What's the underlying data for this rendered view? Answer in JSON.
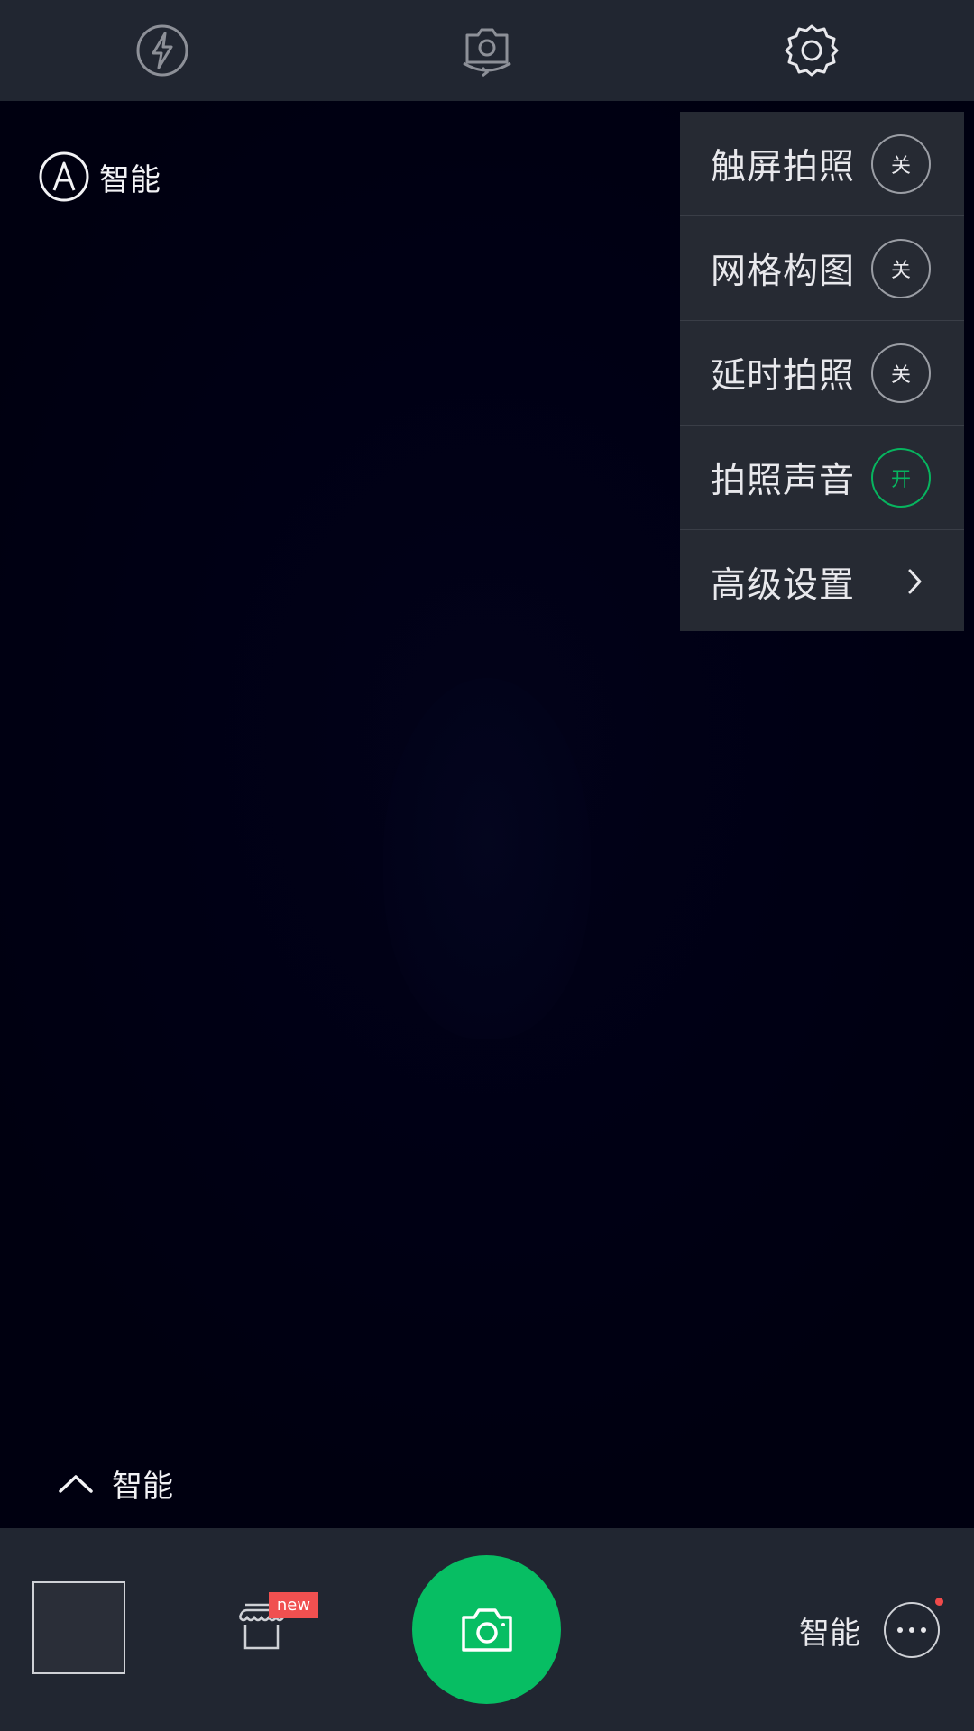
{
  "topbar": {
    "flash_icon": "flash-off-icon",
    "switch_camera_icon": "switch-camera-icon",
    "settings_icon": "gear-icon"
  },
  "viewfinder": {
    "mode_badge": {
      "icon": "auto-mode-icon",
      "label": "智能"
    },
    "scene_selector": {
      "icon": "chevron-up-icon",
      "label": "智能"
    }
  },
  "settings_menu": {
    "items": [
      {
        "label": "触屏拍照",
        "state": "关"
      },
      {
        "label": "网格构图",
        "state": "关"
      },
      {
        "label": "延时拍照",
        "state": "关"
      },
      {
        "label": "拍照声音",
        "state": "开"
      },
      {
        "label": "高级设置",
        "icon": "chevron-right-icon"
      }
    ]
  },
  "bottombar": {
    "gallery_icon": "gallery-thumbnail",
    "store_icon": "store-icon",
    "new_badge": "new",
    "shutter_icon": "camera-icon",
    "mode_label": "智能",
    "more_icon": "more-icon"
  },
  "colors": {
    "accent_green": "#07be63",
    "badge_red": "#f05050",
    "bar_background": "#212631",
    "menu_background": "#262a33"
  }
}
